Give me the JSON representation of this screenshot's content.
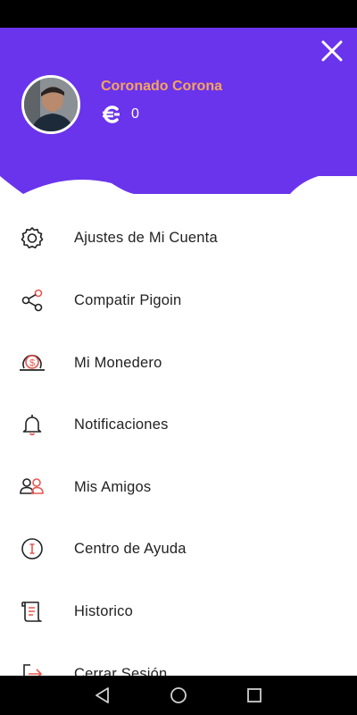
{
  "user": {
    "name": "Coronado Corona",
    "coins": "0"
  },
  "menu": {
    "items": [
      {
        "label": "Ajustes de Mi Cuenta",
        "icon": "gear-icon"
      },
      {
        "label": "Compatir Pigoin",
        "icon": "share-icon"
      },
      {
        "label": "Mi Monedero",
        "icon": "wallet-icon"
      },
      {
        "label": "Notificaciones",
        "icon": "bell-icon"
      },
      {
        "label": "Mis Amigos",
        "icon": "friends-icon"
      },
      {
        "label": "Centro de Ayuda",
        "icon": "help-icon"
      },
      {
        "label": "Historico",
        "icon": "history-icon"
      },
      {
        "label": "Cerrar Sesión",
        "icon": "logout-icon"
      }
    ]
  },
  "colors": {
    "header": "#6a34ec",
    "username": "#f7a45d",
    "icon_accent": "#e8564f"
  }
}
